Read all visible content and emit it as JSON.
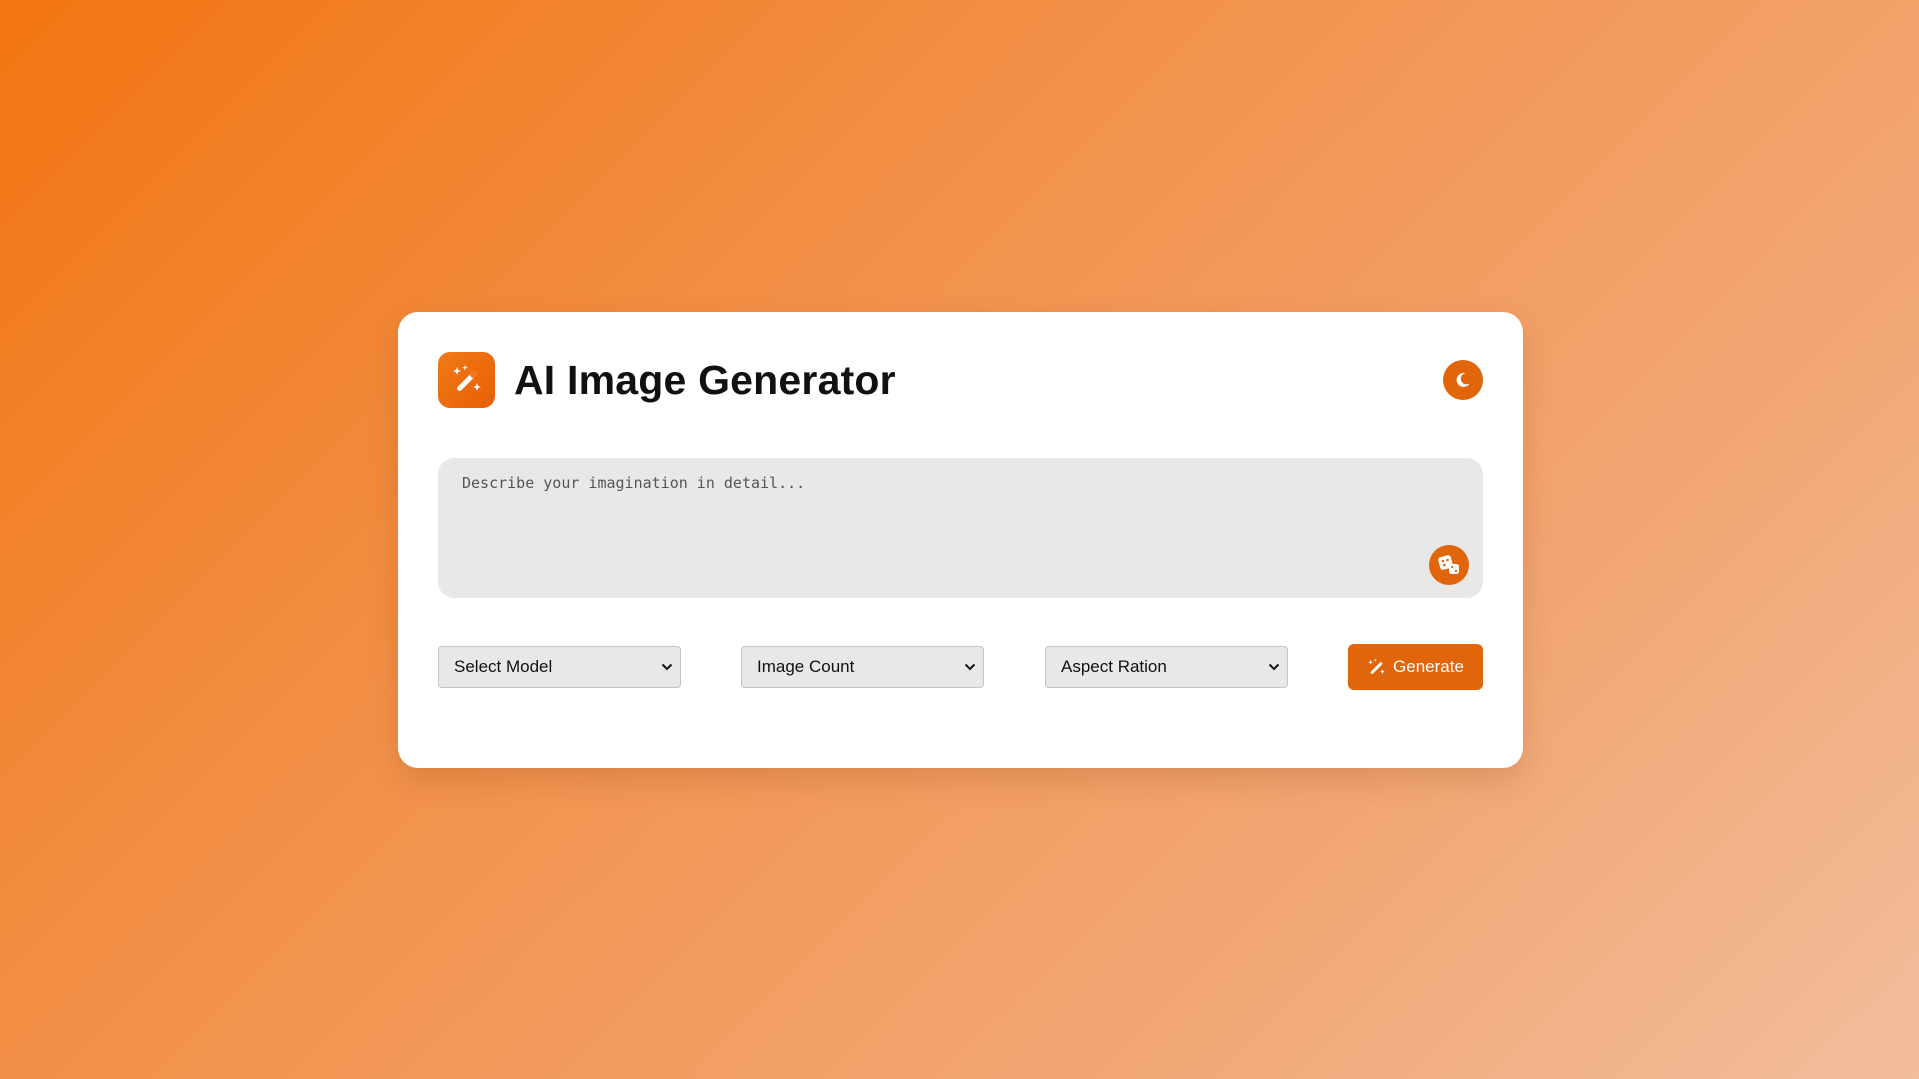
{
  "app": {
    "title": "AI Image Generator",
    "logo_icon": "magic-wand-icon",
    "theme_toggle_icon": "moon-icon"
  },
  "prompt": {
    "placeholder": "Describe your imagination in detail...",
    "value": "",
    "random_button_icon": "dice-icon"
  },
  "controls": {
    "model_select": {
      "selected": "Select Model"
    },
    "count_select": {
      "selected": "Image Count"
    },
    "ratio_select": {
      "selected": "Aspect Ration"
    },
    "generate_button": {
      "label": "Generate",
      "icon": "magic-wand-icon"
    }
  },
  "colors": {
    "accent": "#e0650b",
    "background_start": "#f27511",
    "background_end": "#f2bd9c",
    "card": "#ffffff",
    "input_bg": "#e8e8e8"
  }
}
